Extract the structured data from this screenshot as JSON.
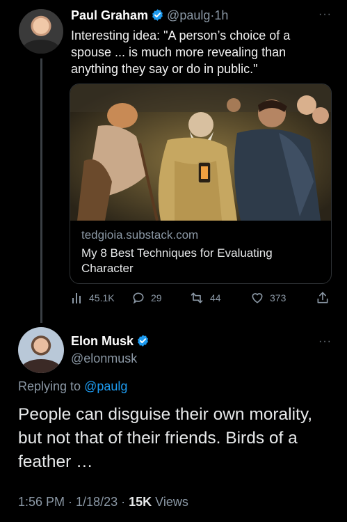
{
  "parent_tweet": {
    "author_name": "Paul Graham",
    "author_handle": "@paulg",
    "separator": "·",
    "time": "1h",
    "more": "···",
    "text": "Interesting idea: \"A person’s choice of a spouse ... is much more revealing than anything they say or do in public.\"",
    "card": {
      "domain": "tedgioia.substack.com",
      "title": "My 8 Best Techniques for Evaluating Character"
    },
    "actions": {
      "views": "45.1K",
      "replies": "29",
      "retweets": "44",
      "likes": "373"
    }
  },
  "reply_tweet": {
    "author_name": "Elon Musk",
    "author_handle": "@elonmusk",
    "more": "···",
    "replying_prefix": "Replying to",
    "replying_to": "@paulg",
    "text": "People can disguise their own morality, but not that of their friends. Birds of a feather …",
    "timestamp": "1:56 PM · 1/18/23 ·",
    "view_count": "15K",
    "views_label": "Views"
  },
  "colors": {
    "background": "#000000",
    "text_primary": "#e7e9ea",
    "text_secondary": "#8b98a5",
    "accent": "#1d9bf0",
    "border": "#2f3336"
  },
  "icons": [
    "verified-badge-icon",
    "more-icon",
    "views-icon",
    "reply-icon",
    "retweet-icon",
    "like-icon",
    "share-icon"
  ]
}
